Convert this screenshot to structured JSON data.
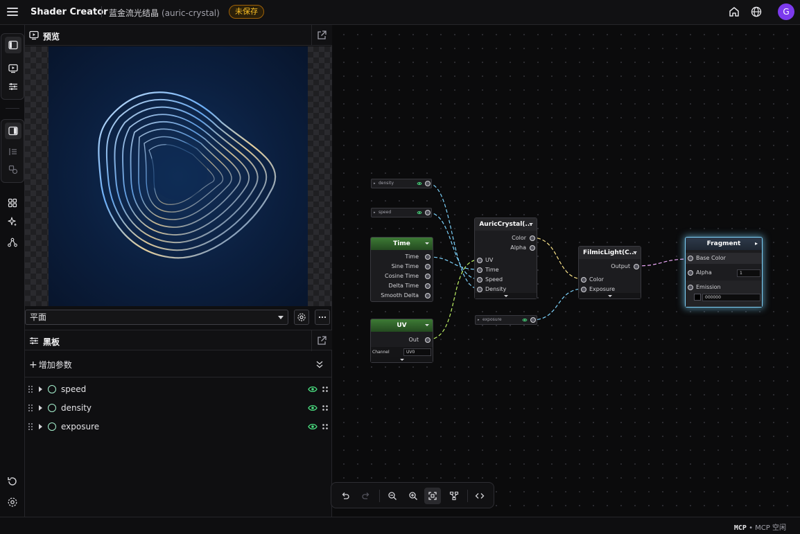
{
  "header": {
    "app_title": "Shader Creator",
    "doc_name": "蓝金流光结晶",
    "doc_slug": "(auric-crystal)",
    "unsaved_badge": "未保存",
    "avatar_initial": "G"
  },
  "rail": {
    "icons": [
      "panel-left-icon",
      "preview-icon",
      "sliders-icon",
      "panel-toggle-icon",
      "list-icon",
      "shapes-icon",
      "grid-icon",
      "sparkles-icon",
      "graph-icon",
      "undo-history-icon",
      "settings-icon"
    ]
  },
  "preview_panel": {
    "title": "预览",
    "view_mode": "平面"
  },
  "blackboard": {
    "title": "黑板",
    "add_param_label": "增加参数",
    "params": [
      {
        "name": "speed"
      },
      {
        "name": "density"
      },
      {
        "name": "exposure"
      }
    ]
  },
  "graph": {
    "param_nodes": {
      "density": "density",
      "speed": "speed",
      "exposure": "exposure"
    },
    "time_node": {
      "title": "Time",
      "outputs": [
        "Time",
        "Sine Time",
        "Cosine Time",
        "Delta Time",
        "Smooth Delta"
      ]
    },
    "uv_node": {
      "title": "UV",
      "output": "Out",
      "channel_label": "Channel",
      "channel_value": "UV0"
    },
    "auric_node": {
      "title": "AuricCrystal(...",
      "outputs": [
        "Color",
        "Alpha"
      ],
      "inputs": [
        "UV",
        "Time",
        "Speed",
        "Density"
      ]
    },
    "filmic_node": {
      "title": "FilmicLight(C...",
      "output": "Output",
      "inputs": [
        "Color",
        "Exposure"
      ]
    },
    "fragment_node": {
      "title": "Fragment",
      "inputs": [
        "Base Color",
        "Alpha",
        "Emission"
      ],
      "alpha_value": "1",
      "emission_value": "000000"
    }
  },
  "status": {
    "mcp_label": "MCP",
    "mcp_state": "MCP 空闲"
  },
  "colors": {
    "accent_badge": "#fbbf24",
    "avatar": "#7c3aed",
    "node_header_green": "#3d7a35",
    "fragment_glow": "#7dd3fc"
  }
}
